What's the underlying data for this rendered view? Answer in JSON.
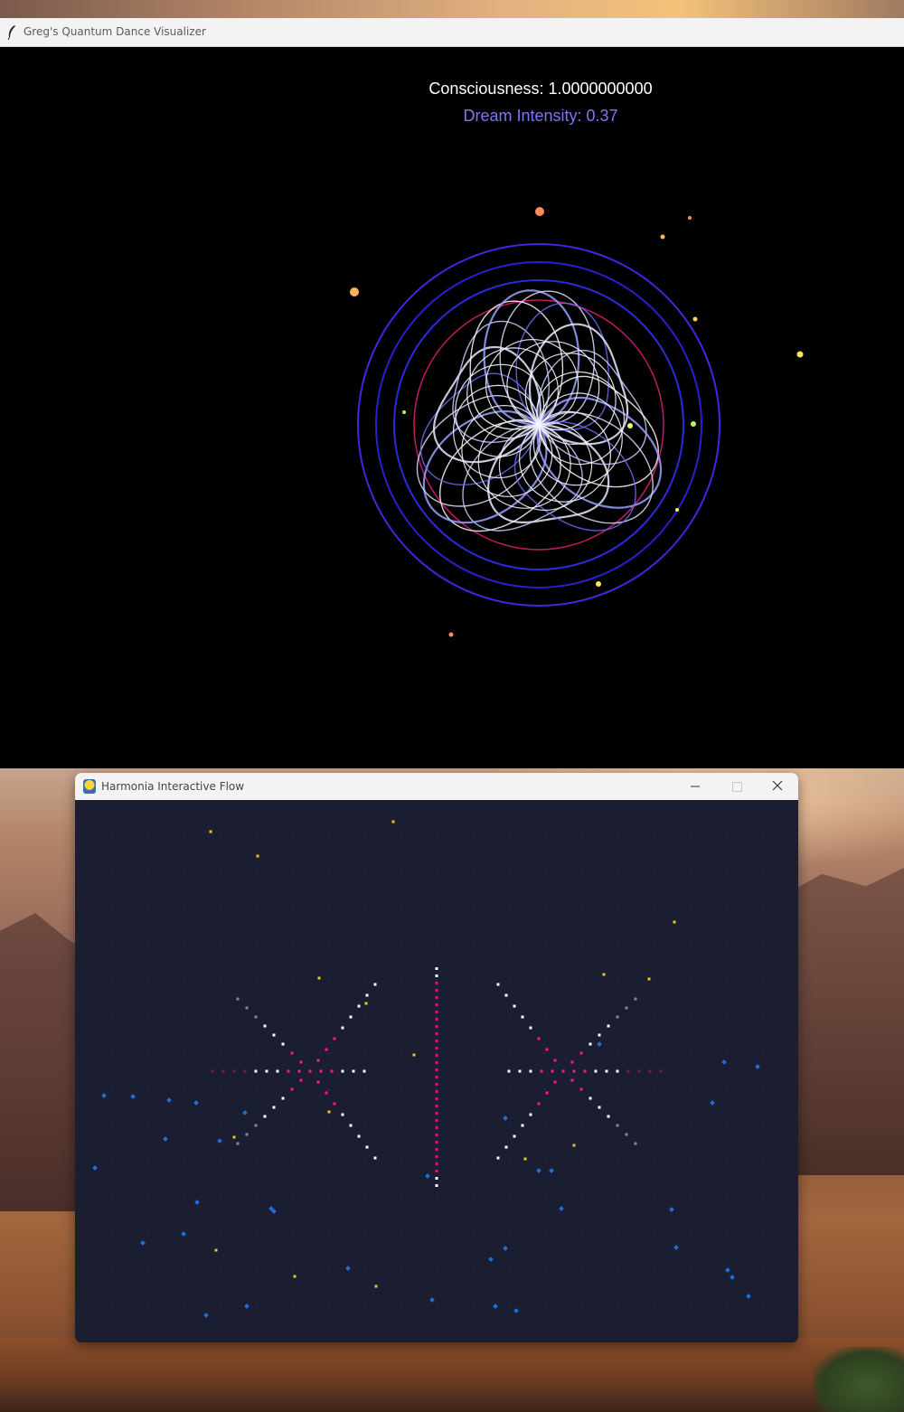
{
  "window1": {
    "title": "Greg's Quantum Dance Visualizer",
    "icon": "feather-icon",
    "consciousness_text": "Consciousness: 1.0000000000",
    "dream_intensity_text": "Dream Intensity: 0.37",
    "colors": {
      "background": "#000000",
      "ring": "#3a1fd6",
      "petals": "#d8dcff",
      "dream_text": "#7b78f0"
    }
  },
  "window2": {
    "title": "Harmonia Interactive Flow",
    "icon": "python-icon",
    "controls": [
      "minimize-icon",
      "maximize-icon",
      "close-icon"
    ],
    "colors": {
      "background": "#1b1d30",
      "pink": "#ff1a8c",
      "white": "#ffffff",
      "blue": "#1f6fd6",
      "gold": "#f0c419"
    }
  }
}
